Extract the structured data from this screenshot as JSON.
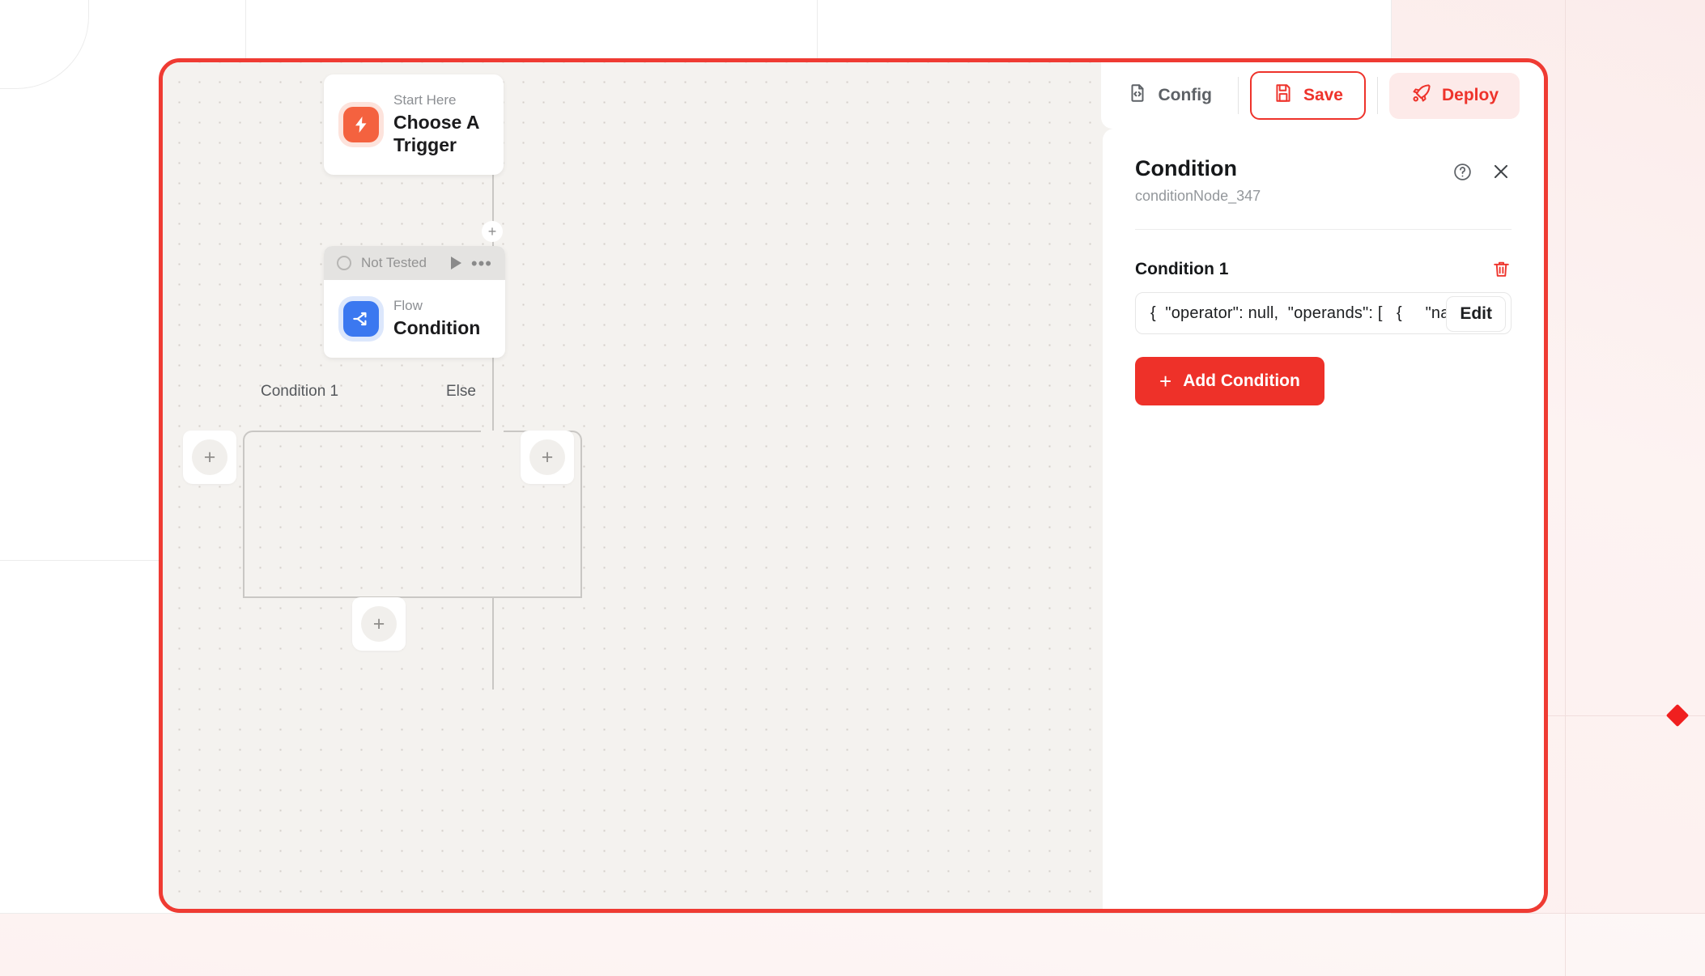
{
  "toolbar": {
    "config_label": "Config",
    "config_icon": "file-code-icon",
    "save_label": "Save",
    "save_icon": "floppy-disk-icon",
    "deploy_label": "Deploy",
    "deploy_icon": "rocket-icon"
  },
  "panel": {
    "title": "Condition",
    "subtitle": "conditionNode_347",
    "help_icon": "question-circle-icon",
    "close_icon": "close-icon",
    "condition_label": "Condition 1",
    "delete_icon": "trash-icon",
    "field_value": "{  \"operator\": null,  \"operands\": [   {     \"na",
    "edit_label": "Edit",
    "add_condition_label": "Add Condition",
    "add_condition_plus": "+"
  },
  "canvas": {
    "trigger_node": {
      "kicker": "Start Here",
      "title": "Choose A Trigger",
      "icon": "lightning-bolt-icon"
    },
    "condition_node": {
      "status": "Not Tested",
      "status_icon": "circle-outline-icon",
      "run_icon": "play-icon",
      "menu_icon": "ellipsis-icon",
      "kicker": "Flow",
      "title": "Condition",
      "icon": "branch-split-icon"
    },
    "branch_labels": {
      "left": "Condition 1",
      "right": "Else"
    },
    "inline_plus": "+",
    "add_node_plus": "+"
  },
  "colors": {
    "accent_red": "#ee332b",
    "frame_red": "#ef3b33",
    "trigger_orange": "#f4623f",
    "flow_blue": "#3b78f0",
    "canvas_bg": "#f4f2ef"
  }
}
